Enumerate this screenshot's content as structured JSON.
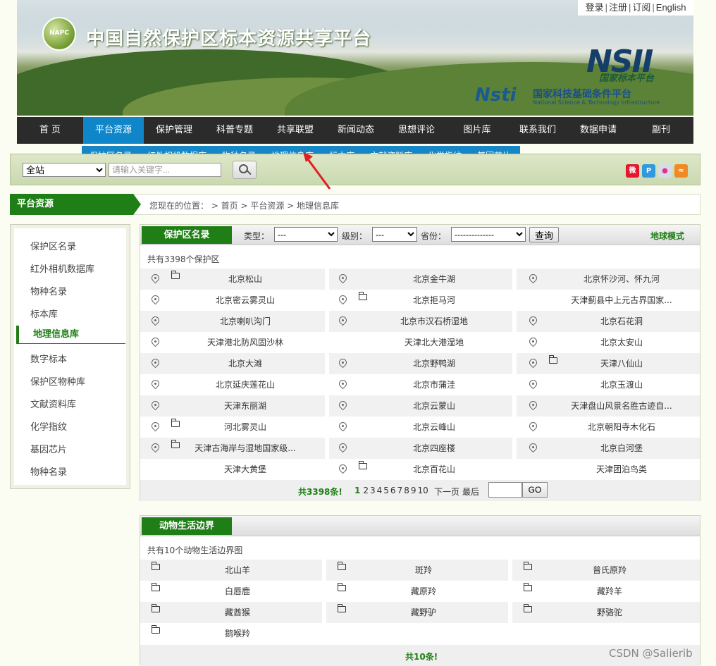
{
  "top_links": {
    "login": "登录",
    "register": "注册",
    "subscribe": "订阅",
    "english": "English"
  },
  "header": {
    "logo_text": "NAPC",
    "site_title": "中国自然保护区标本资源共享平台",
    "nsii": "NSII",
    "nsii_sub": "国家标本平台",
    "nsti": "Nsti",
    "nsti_cn": "国家科技基础条件平台",
    "nsti_en": "National Science & Technology Infrastructure"
  },
  "nav": [
    "首 页",
    "平台资源",
    "保护管理",
    "科普专题",
    "共享联盟",
    "新闻动态",
    "思想评论",
    "图片库",
    "联系我们",
    "数据申请",
    "副刊"
  ],
  "subnav": [
    "保护区名录",
    "红外相机数据库",
    "物种名录",
    "地理信息库",
    "标本库",
    "文献资料库",
    "化学指纹",
    "基因芯片"
  ],
  "search": {
    "scope": "全站",
    "placeholder": "请输入关键字..."
  },
  "social": [
    {
      "name": "weibo-icon",
      "color": "#e6162d",
      "glyph": "微"
    },
    {
      "name": "p-icon",
      "color": "#2f9ae0",
      "glyph": "P"
    },
    {
      "name": "flickr-icon",
      "color": "#d7dde8",
      "glyph": "●"
    },
    {
      "name": "rss-icon",
      "color": "#f08a24",
      "glyph": "≈"
    }
  ],
  "breadcrumb": {
    "section": "平台资源",
    "text": "您现在的位置：  > 首页 > 平台资源 > 地理信息库"
  },
  "sidebar": [
    "保护区名录",
    "红外相机数据库",
    "物种名录",
    "标本库",
    "地理信息库",
    "数字标本",
    "保护区物种库",
    "文献资料库",
    "化学指纹",
    "基因芯片",
    "物种名录"
  ],
  "reserves_panel": {
    "tab": "保护区名录",
    "type_label": "类型：",
    "type_value": "---",
    "level_label": "级别：",
    "level_value": "---",
    "province_label": "省份：",
    "province_value": "--------------",
    "query_btn": "查询",
    "globe_mode": "地球模式",
    "count_text": "共有3398个保护区",
    "rows": [
      [
        {
          "name": "北京松山",
          "pin": true,
          "folder": true
        },
        {
          "name": "北京金牛湖",
          "pin": true,
          "folder": false
        },
        {
          "name": "北京怀沙河、怀九河",
          "pin": true,
          "folder": false
        }
      ],
      [
        {
          "name": "北京密云雾灵山",
          "pin": true,
          "folder": false
        },
        {
          "name": "北京拒马河",
          "pin": true,
          "folder": true
        },
        {
          "name": "天津蓟县中上元古界国家...",
          "pin": false,
          "folder": false
        }
      ],
      [
        {
          "name": "北京喇叭沟门",
          "pin": true,
          "folder": false
        },
        {
          "name": "北京市汉石桥湿地",
          "pin": true,
          "folder": false
        },
        {
          "name": "北京石花洞",
          "pin": true,
          "folder": false
        }
      ],
      [
        {
          "name": "天津港北防风固沙林",
          "pin": true,
          "folder": false
        },
        {
          "name": "天津北大港湿地",
          "pin": false,
          "folder": false
        },
        {
          "name": "北京太安山",
          "pin": true,
          "folder": false
        }
      ],
      [
        {
          "name": "北京大滩",
          "pin": true,
          "folder": false
        },
        {
          "name": "北京野鸭湖",
          "pin": true,
          "folder": false
        },
        {
          "name": "天津八仙山",
          "pin": true,
          "folder": true
        }
      ],
      [
        {
          "name": "北京延庆莲花山",
          "pin": true,
          "folder": false
        },
        {
          "name": "北京市蒲洼",
          "pin": true,
          "folder": false
        },
        {
          "name": "北京玉渡山",
          "pin": true,
          "folder": false
        }
      ],
      [
        {
          "name": "天津东丽湖",
          "pin": true,
          "folder": false
        },
        {
          "name": "北京云蒙山",
          "pin": true,
          "folder": false
        },
        {
          "name": "天津盘山风景名胜古迹自...",
          "pin": true,
          "folder": false
        }
      ],
      [
        {
          "name": "河北雾灵山",
          "pin": true,
          "folder": true
        },
        {
          "name": "北京云峰山",
          "pin": true,
          "folder": false
        },
        {
          "name": "北京朝阳寺木化石",
          "pin": true,
          "folder": false
        }
      ],
      [
        {
          "name": "天津古海岸与湿地国家级...",
          "pin": true,
          "folder": true
        },
        {
          "name": "北京四座楼",
          "pin": true,
          "folder": false
        },
        {
          "name": "北京白河堡",
          "pin": true,
          "folder": false
        }
      ],
      [
        {
          "name": "天津大黄堡",
          "pin": false,
          "folder": false
        },
        {
          "name": "北京百花山",
          "pin": true,
          "folder": true
        },
        {
          "name": "天津团泊鸟类",
          "pin": false,
          "folder": false
        }
      ]
    ],
    "total": "共3398条!",
    "pages": [
      "1",
      "2",
      "3",
      "4",
      "5",
      "6",
      "7",
      "8",
      "9",
      "10"
    ],
    "next": "下一页",
    "last": "最后",
    "go": "GO"
  },
  "animal_panel": {
    "tab": "动物生活边界",
    "count_text": "共有10个动物生活边界图",
    "rows": [
      [
        "北山羊",
        "斑羚",
        "普氏原羚"
      ],
      [
        "白唇鹿",
        "藏原羚",
        "藏羚羊"
      ],
      [
        "藏酋猴",
        "藏野驴",
        "野骆驼"
      ],
      [
        "鹅喉羚"
      ]
    ],
    "total": "共10条!"
  },
  "watermark": "CSDN @Salierib"
}
